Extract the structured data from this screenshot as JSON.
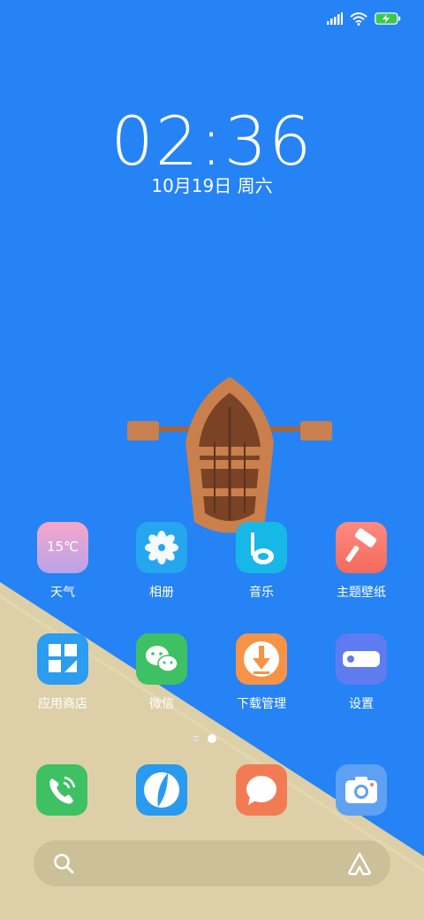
{
  "status_bar": {
    "signal": "signal-icon",
    "wifi": "wifi-icon",
    "battery": "battery-charging-icon",
    "battery_color": "#3cc84f"
  },
  "clock": {
    "time": "02:36",
    "date": "10月19日 周六"
  },
  "apps_row1": [
    {
      "label": "天气",
      "icon": "weather-icon",
      "icon_text": "15℃"
    },
    {
      "label": "相册",
      "icon": "gallery-icon"
    },
    {
      "label": "音乐",
      "icon": "music-icon"
    },
    {
      "label": "主题壁纸",
      "icon": "theme-icon"
    }
  ],
  "apps_row2": [
    {
      "label": "应用商店",
      "icon": "app-store-icon"
    },
    {
      "label": "微信",
      "icon": "wechat-icon"
    },
    {
      "label": "下载管理",
      "icon": "download-icon"
    },
    {
      "label": "设置",
      "icon": "settings-icon"
    }
  ],
  "dock": [
    {
      "icon": "phone-icon"
    },
    {
      "icon": "browser-icon"
    },
    {
      "icon": "messages-icon"
    },
    {
      "icon": "camera-icon"
    }
  ],
  "page_indicator": {
    "pages": 2,
    "current": 1
  },
  "search": {
    "icon": "search-icon",
    "assistant_icon": "assistant-icon"
  },
  "colors": {
    "sky": "#2583f5",
    "sand": "#ddd0a9",
    "accent_green": "#3cc84f"
  }
}
